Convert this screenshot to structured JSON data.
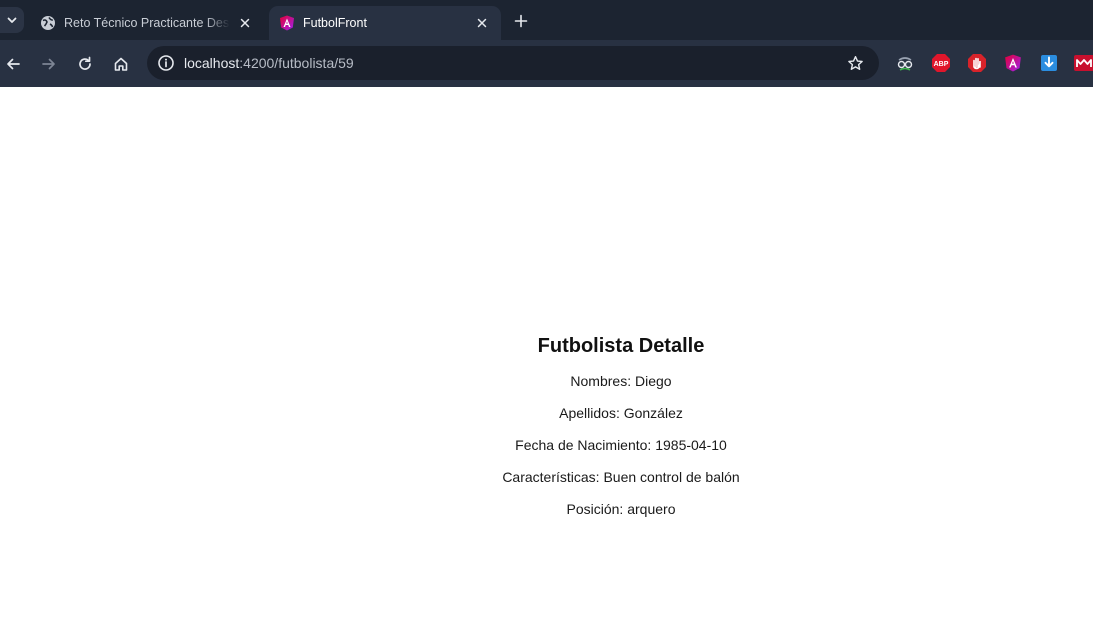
{
  "browser": {
    "tabs": [
      {
        "title": "Reto Técnico Practicante Desarrollo",
        "favicon": "globe-icon",
        "active": false
      },
      {
        "title": "FutbolFront",
        "favicon": "angular-icon",
        "active": true
      }
    ],
    "address": {
      "host": "localhost",
      "rest": ":4200/futbolista/59"
    },
    "extensions": [
      "spy-glasses-icon",
      "adblock-plus-icon",
      "stop-hand-icon",
      "angular-devtools-icon",
      "download-icon",
      "mendeley-icon"
    ],
    "colors": {
      "tabstrip": "#1c2431",
      "toolbar": "#283142",
      "omnibox": "#1a202c"
    }
  },
  "page": {
    "title": "Futbolista Detalle",
    "fields": [
      {
        "label": "Nombres:",
        "value": "Diego"
      },
      {
        "label": "Apellidos:",
        "value": "González"
      },
      {
        "label": "Fecha de Nacimiento:",
        "value": "1985-04-10"
      },
      {
        "label": "Características:",
        "value": "Buen control de balón"
      },
      {
        "label": "Posición:",
        "value": "arquero"
      }
    ]
  }
}
